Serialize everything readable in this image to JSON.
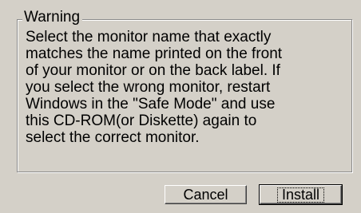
{
  "dialog": {
    "group_title": "Warning",
    "message": "Select the monitor name that exactly\nmatches the name printed on the front\nof your monitor or on the back label. If\nyou select the wrong monitor, restart\nWindows in the \"Safe Mode\" and use\nthis CD-ROM(or Diskette) again to\nselect the correct monitor."
  },
  "buttons": {
    "cancel_label": "Cancel",
    "install_label": "Install"
  }
}
